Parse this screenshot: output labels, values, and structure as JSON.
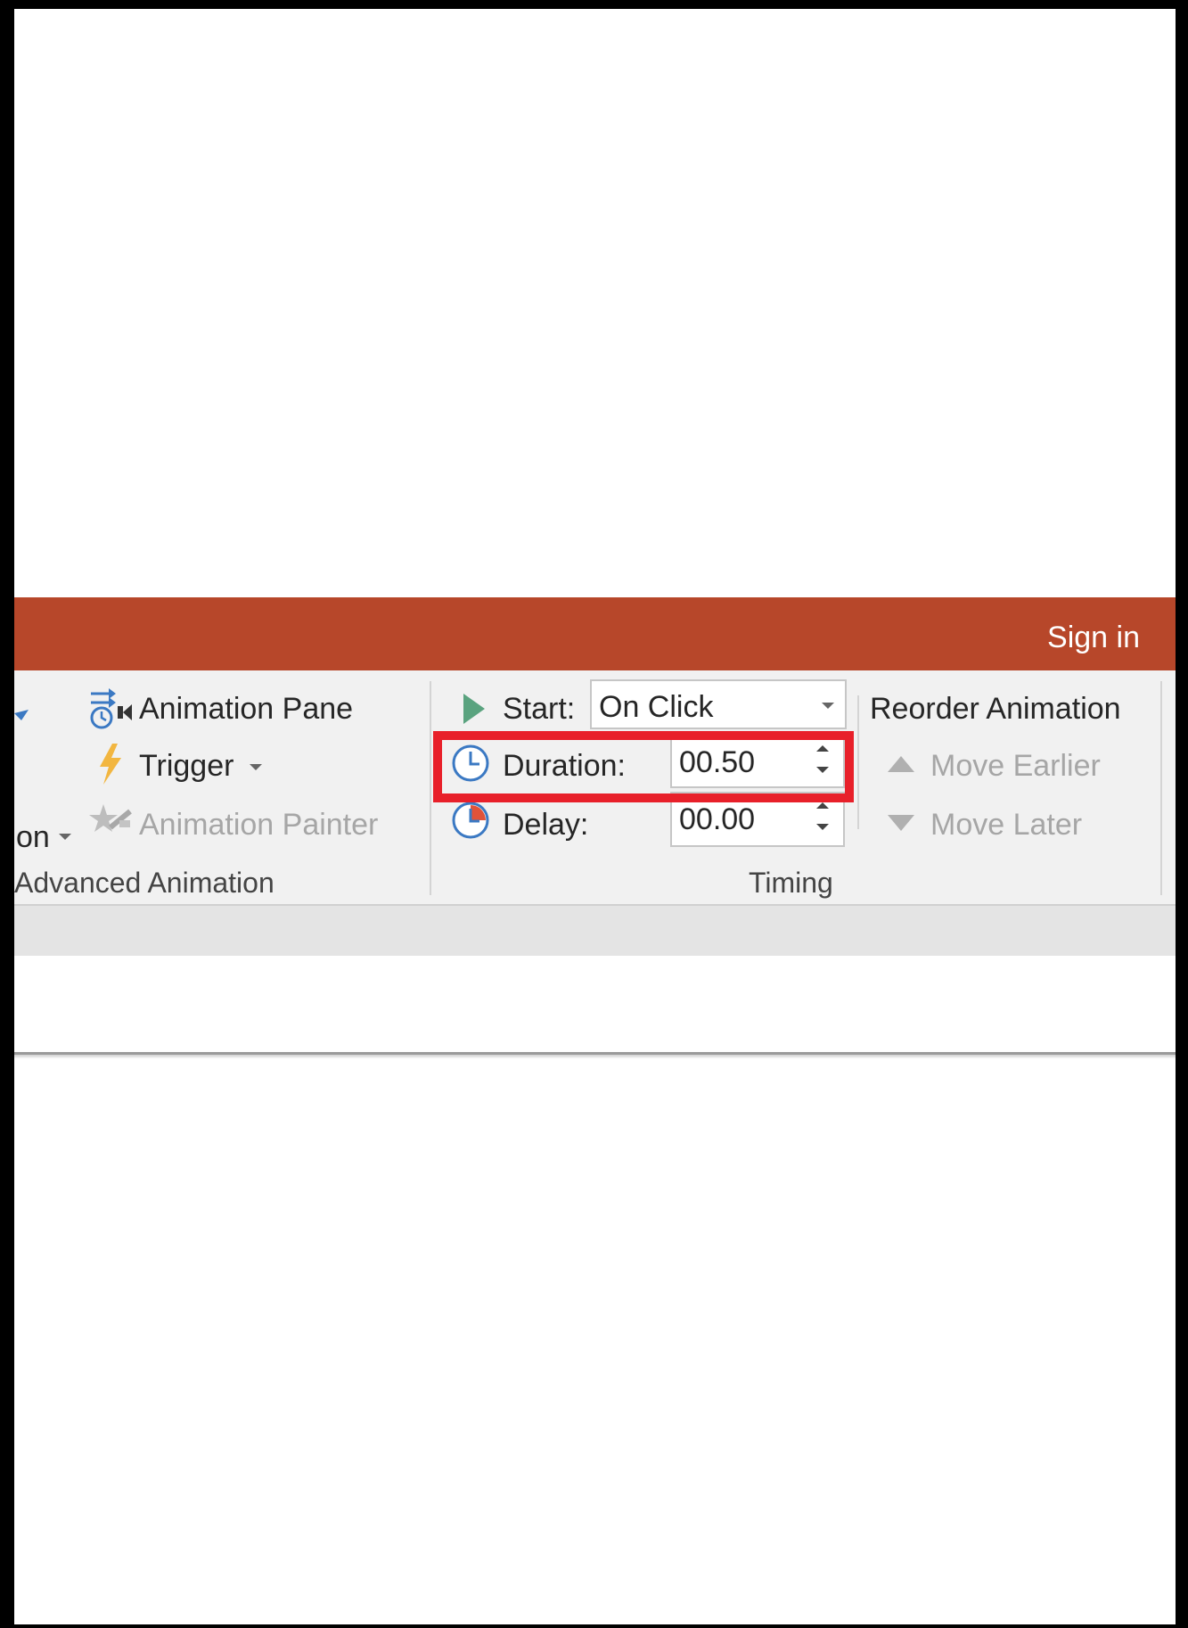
{
  "titlebar": {
    "sign_in": "Sign in",
    "color": "#b7472a"
  },
  "advanced_animation": {
    "partial_label": "on",
    "animation_pane": "Animation Pane",
    "trigger": "Trigger",
    "animation_painter": "Animation Painter",
    "group_label": "Advanced Animation"
  },
  "timing": {
    "start_label": "Start:",
    "start_value": "On Click",
    "duration_label": "Duration:",
    "duration_value": "00.50",
    "delay_label": "Delay:",
    "delay_value": "00.00",
    "group_label": "Timing"
  },
  "reorder": {
    "title": "Reorder Animation",
    "move_earlier": "Move Earlier",
    "move_later": "Move Later"
  },
  "icons": {
    "animation_pane": "animation-pane-icon",
    "trigger": "lightning-icon",
    "animation_painter": "animation-painter-icon",
    "start": "play-icon",
    "duration": "clock-icon",
    "delay": "delay-clock-icon",
    "move_earlier": "triangle-up-icon",
    "move_later": "triangle-down-icon"
  },
  "highlight": {
    "target": "Duration",
    "color": "#e8202a"
  }
}
